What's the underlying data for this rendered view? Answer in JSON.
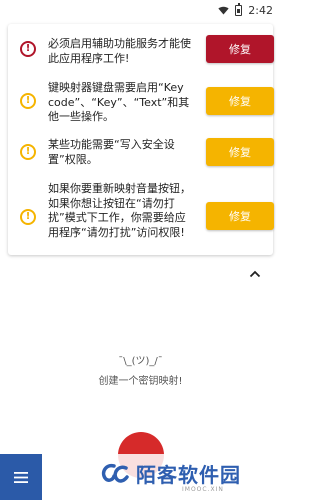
{
  "status_bar": {
    "time": "2:42"
  },
  "warnings": [
    {
      "text": "必须启用辅助功能服务才能使此应用程序工作!",
      "button": "修复",
      "severity": "error"
    },
    {
      "text": "键映射器键盘需要启用“Key code”、“Key”、“Text”和其他一些操作。",
      "button": "修复",
      "severity": "warning"
    },
    {
      "text": "某些功能需要“写入安全设置”权限。",
      "button": "修复",
      "severity": "warning"
    },
    {
      "text": "如果你要重新映射音量按钮，如果你想让按钮在“请勿打扰”模式下工作，你需要给应用程序“请勿打扰”访问权限!",
      "button": "修复",
      "severity": "warning"
    }
  ],
  "empty_state": {
    "face": "¯\\_(ツ)_/¯",
    "message": "创建一个密钥映射!"
  },
  "watermark": {
    "title": "陌客软件园",
    "subtitle": "IMOOC.XIN"
  },
  "colors": {
    "error": "#b0152a",
    "warning": "#f5b400",
    "primary": "#2b5aa8",
    "fab": "#d62a2a"
  }
}
